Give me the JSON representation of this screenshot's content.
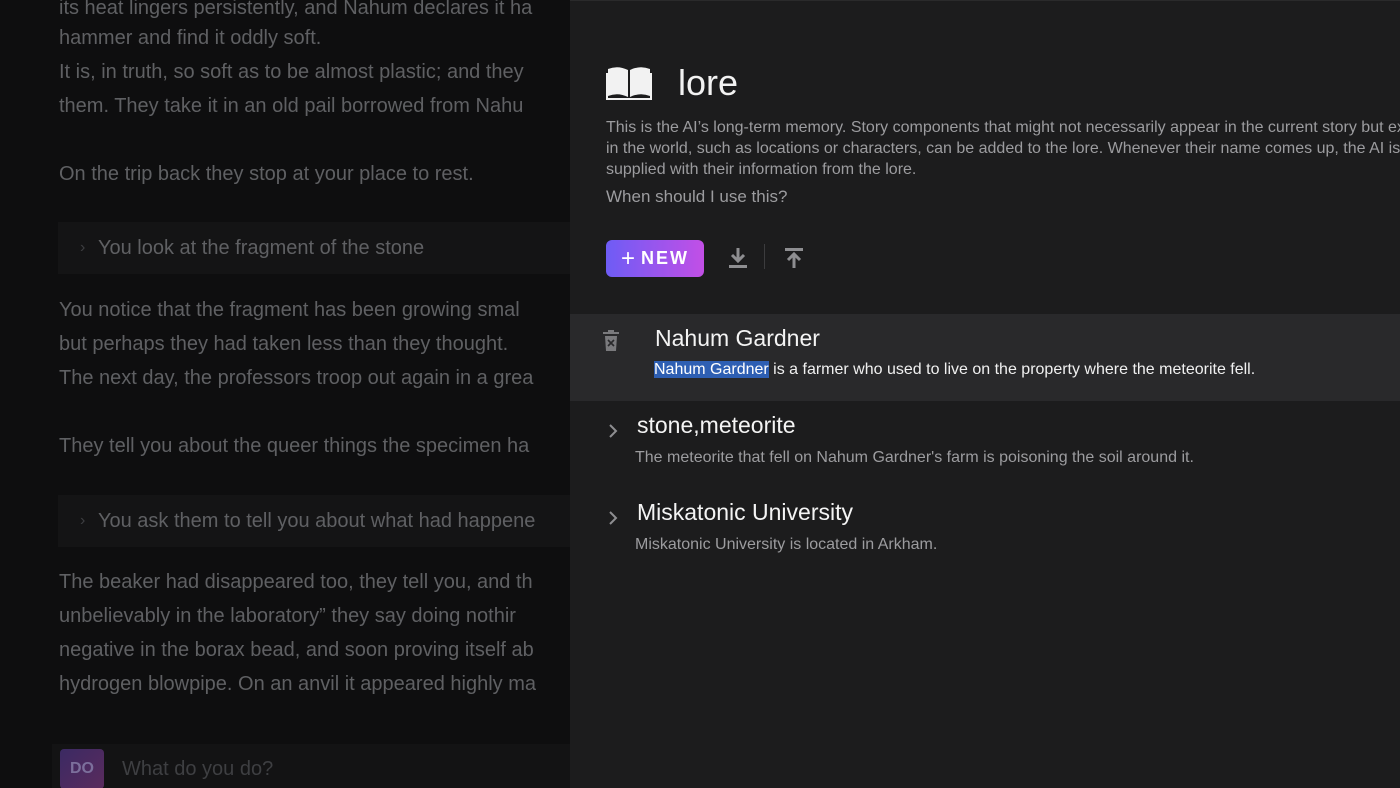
{
  "story": {
    "paragraphs": [
      "its heat lingers persistently, and Nahum declares it ha",
      "hammer and find it oddly soft.",
      "It is, in truth, so soft as to be almost plastic; and they",
      "them. They take it in an old pail borrowed from Nahu",
      "On the trip back they stop at your place to rest.",
      "You notice that the fragment has been growing smal",
      "but perhaps they had taken less than they thought.",
      "The next day, the professors troop out again in a grea",
      "They tell you about the queer things the specimen ha",
      "The beaker had disappeared too, they tell you, and th",
      "unbelievably in the laboratory” they say   doing nothir",
      "negative in the borax bead, and soon proving itself ab",
      "hydrogen blowpipe. On an anvil it appeared highly ma"
    ],
    "actions": [
      "You look at the fragment of the stone",
      "You ask them to tell you about what had happene"
    ],
    "input": {
      "mode_badge": "DO",
      "placeholder": "What do you do?"
    }
  },
  "lore": {
    "title": "lore",
    "description": "This is the AI’s long-term memory. Story components that might not necessarily appear in the current story but exist in the world, such as locations or characters, can be added to the lore. Whenever their name comes up, the AI is supplied with their information from the lore.",
    "help_link": "When should I use this?",
    "new_button": "NEW",
    "entries": [
      {
        "name": "Nahum Gardner",
        "highlight": "Nahum Gardner",
        "rest": " is a farmer who used to live on the property where the meteorite fell."
      },
      {
        "name": "stone,meteorite",
        "text": "The meteorite that fell on Nahum Gardner's farm is poisoning the soil around it."
      },
      {
        "name": "Miskatonic University",
        "text": "Miskatonic University is located in Arkham."
      }
    ]
  }
}
